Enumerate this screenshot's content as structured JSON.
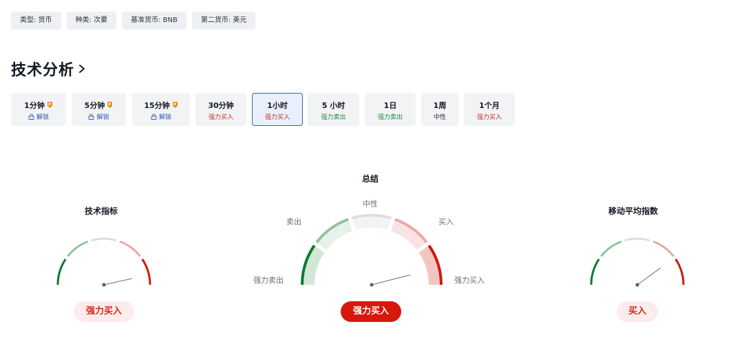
{
  "tags": [
    {
      "text": "类型: 货币"
    },
    {
      "text": "种类: 次要"
    },
    {
      "text": "基准货币: BNB"
    },
    {
      "text": "第二货币: 美元"
    }
  ],
  "section": {
    "title": "技术分析"
  },
  "periods": [
    {
      "label": "1分钟",
      "sub": "解锁",
      "kind": "unlock",
      "premium": true
    },
    {
      "label": "5分钟",
      "sub": "解锁",
      "kind": "unlock",
      "premium": true
    },
    {
      "label": "15分钟",
      "sub": "解锁",
      "kind": "unlock",
      "premium": true
    },
    {
      "label": "30分钟",
      "sub": "强力买入",
      "kind": "buy",
      "premium": false
    },
    {
      "label": "1小时",
      "sub": "强力买入",
      "kind": "buy",
      "premium": false,
      "active": true
    },
    {
      "label": "5 小时",
      "sub": "强力卖出",
      "kind": "sell",
      "premium": false
    },
    {
      "label": "1日",
      "sub": "强力卖出",
      "kind": "sell",
      "premium": false
    },
    {
      "label": "1周",
      "sub": "中性",
      "kind": "neutral",
      "premium": false
    },
    {
      "label": "1个月",
      "sub": "强力买入",
      "kind": "buy",
      "premium": false
    }
  ],
  "gauges": {
    "indicators": {
      "title": "技术指标",
      "verdict": "强力买入",
      "needle_fraction": 0.93
    },
    "summary": {
      "title": "总结",
      "verdict": "强力买入",
      "needle_fraction": 0.92,
      "labels": {
        "strong_sell": "强力卖出",
        "sell": "卖出",
        "neutral": "中性",
        "buy": "买入",
        "strong_buy": "强力买入"
      }
    },
    "moving_averages": {
      "title": "移动平均指数",
      "verdict": "买入",
      "needle_fraction": 0.8
    }
  },
  "colors": {
    "strong_sell": "#0b7a2e",
    "sell": "#8fc39d",
    "neutral": "#dcdde0",
    "buy": "#eba7a3",
    "strong_buy": "#d0170b",
    "verdict_solid": "#d6180d",
    "verdict_soft_bg": "#fdeceb"
  },
  "icons": {
    "premium": "premium-gem-icon",
    "lock": "lock-icon",
    "chevron": "chevron-right-icon"
  }
}
